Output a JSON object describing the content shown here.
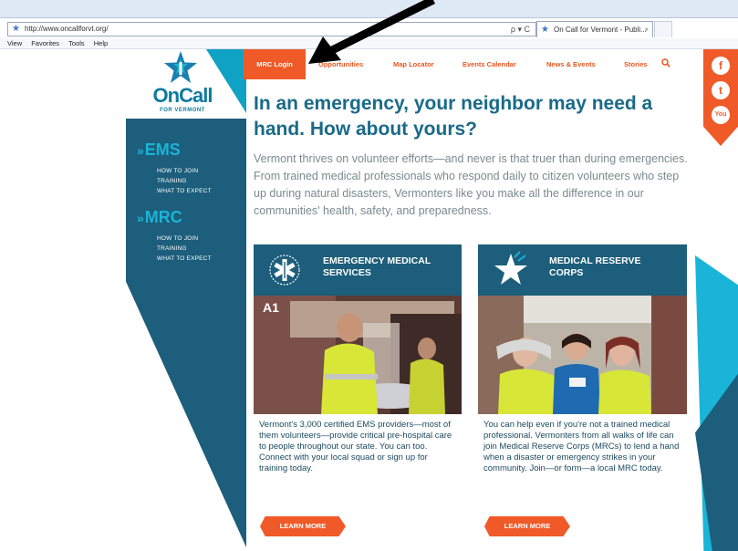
{
  "browser": {
    "url": "http://www.oncallforvt.org/",
    "url_controls": "ρ ▾ C",
    "tab_label": "On Call for Vermont - Publi...",
    "tab_close": "×",
    "menu": [
      "View",
      "Favorites",
      "Tools",
      "Help"
    ]
  },
  "logo": {
    "title": "OnCall",
    "sub": "FOR VERMONT"
  },
  "sidenav": {
    "sections": [
      {
        "title": "EMS",
        "links": [
          "HOW TO JOIN",
          "TRAINING",
          "WHAT TO EXPECT"
        ]
      },
      {
        "title": "MRC",
        "links": [
          "HOW TO JOIN",
          "TRAINING",
          "WHAT TO EXPECT"
        ]
      }
    ]
  },
  "nav": {
    "active": "MRC Login",
    "links": [
      "Opportunities",
      "Map Locator",
      "Events Calendar",
      "News & Events",
      "Stories"
    ]
  },
  "social": [
    "f",
    "t",
    "You"
  ],
  "main": {
    "headline": "In an emergency, your neighbor may need a hand. How about yours?",
    "intro": "Vermont thrives on volunteer efforts—and never is that truer than during emergencies. From trained medical professionals who respond daily to citizen volunteers who step up during natural disasters, Vermonters like you make all the difference in our communities' health, safety, and preparedness."
  },
  "cards": [
    {
      "title": "EMERGENCY MEDICAL SERVICES",
      "photo_label": "A1",
      "text": "Vermont's 3,000 certified EMS providers—most of them volunteers—provide critical pre-hospital care to people throughout our state. You can too. Connect with your local squad or sign up for training today.",
      "button": "LEARN MORE"
    },
    {
      "title": "MEDICAL RESERVE CORPS",
      "text": "You can help even if you're not a trained medical professional. Vermonters from all walks of life can join Medical Reserve Corps (MRCs) to lend a hand when a disaster or emergency strikes in your community. Join—or form—a local MRC today.",
      "button": "LEARN MORE"
    }
  ],
  "colors": {
    "orange": "#f05a28",
    "navy": "#1c5e7b",
    "teal": "#19b4d8",
    "headline": "#1a6a88"
  }
}
